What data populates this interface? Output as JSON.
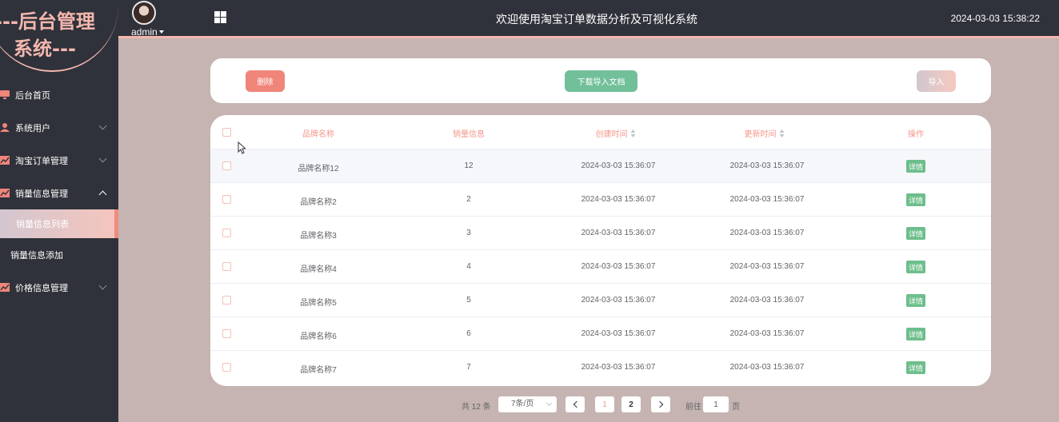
{
  "sidebar": {
    "logo_line1": "---后台管理",
    "logo_line2": "系统---",
    "menu": [
      {
        "label": "后台首页",
        "icon": "monitor-icon"
      },
      {
        "label": "系统用户",
        "icon": "user-icon"
      },
      {
        "label": "淘宝订单管理",
        "icon": "chart-icon"
      },
      {
        "label": "销量信息管理",
        "icon": "chart-icon"
      },
      {
        "label": "销量信息列表"
      },
      {
        "label": "销量信息添加"
      },
      {
        "label": "价格信息管理",
        "icon": "chart-icon"
      }
    ]
  },
  "header": {
    "username": "admin",
    "title": "欢迎使用淘宝订单数据分析及可视化系统",
    "datetime": "2024-03-03 15:38:22"
  },
  "actions": {
    "delete": "删除",
    "download": "下载导入文档",
    "import": "导入"
  },
  "table": {
    "headers": {
      "brand": "品牌名称",
      "sales": "销量信息",
      "created": "创建时间",
      "updated": "更新时间",
      "ops": "操作"
    },
    "detail_label": "详情",
    "rows": [
      {
        "brand": "品牌名称12",
        "sales": "12",
        "created": "2024-03-03 15:36:07",
        "updated": "2024-03-03 15:36:07"
      },
      {
        "brand": "品牌名称2",
        "sales": "2",
        "created": "2024-03-03 15:36:07",
        "updated": "2024-03-03 15:36:07"
      },
      {
        "brand": "品牌名称3",
        "sales": "3",
        "created": "2024-03-03 15:36:07",
        "updated": "2024-03-03 15:36:07"
      },
      {
        "brand": "品牌名称4",
        "sales": "4",
        "created": "2024-03-03 15:36:07",
        "updated": "2024-03-03 15:36:07"
      },
      {
        "brand": "品牌名称5",
        "sales": "5",
        "created": "2024-03-03 15:36:07",
        "updated": "2024-03-03 15:36:07"
      },
      {
        "brand": "品牌名称6",
        "sales": "6",
        "created": "2024-03-03 15:36:07",
        "updated": "2024-03-03 15:36:07"
      },
      {
        "brand": "品牌名称7",
        "sales": "7",
        "created": "2024-03-03 15:36:07",
        "updated": "2024-03-03 15:36:07"
      }
    ]
  },
  "pagination": {
    "total": "共 12 条",
    "page_size": "7条/页",
    "pages": [
      "1",
      "2"
    ],
    "current": "1",
    "goto_prefix": "前往",
    "goto_value": "1",
    "goto_suffix": "页"
  },
  "colors": {
    "accent": "#f4968a",
    "sidebar_bg": "#2f323a",
    "page_bg": "#c5b4b1",
    "detail_green": "#6dbe8b"
  }
}
